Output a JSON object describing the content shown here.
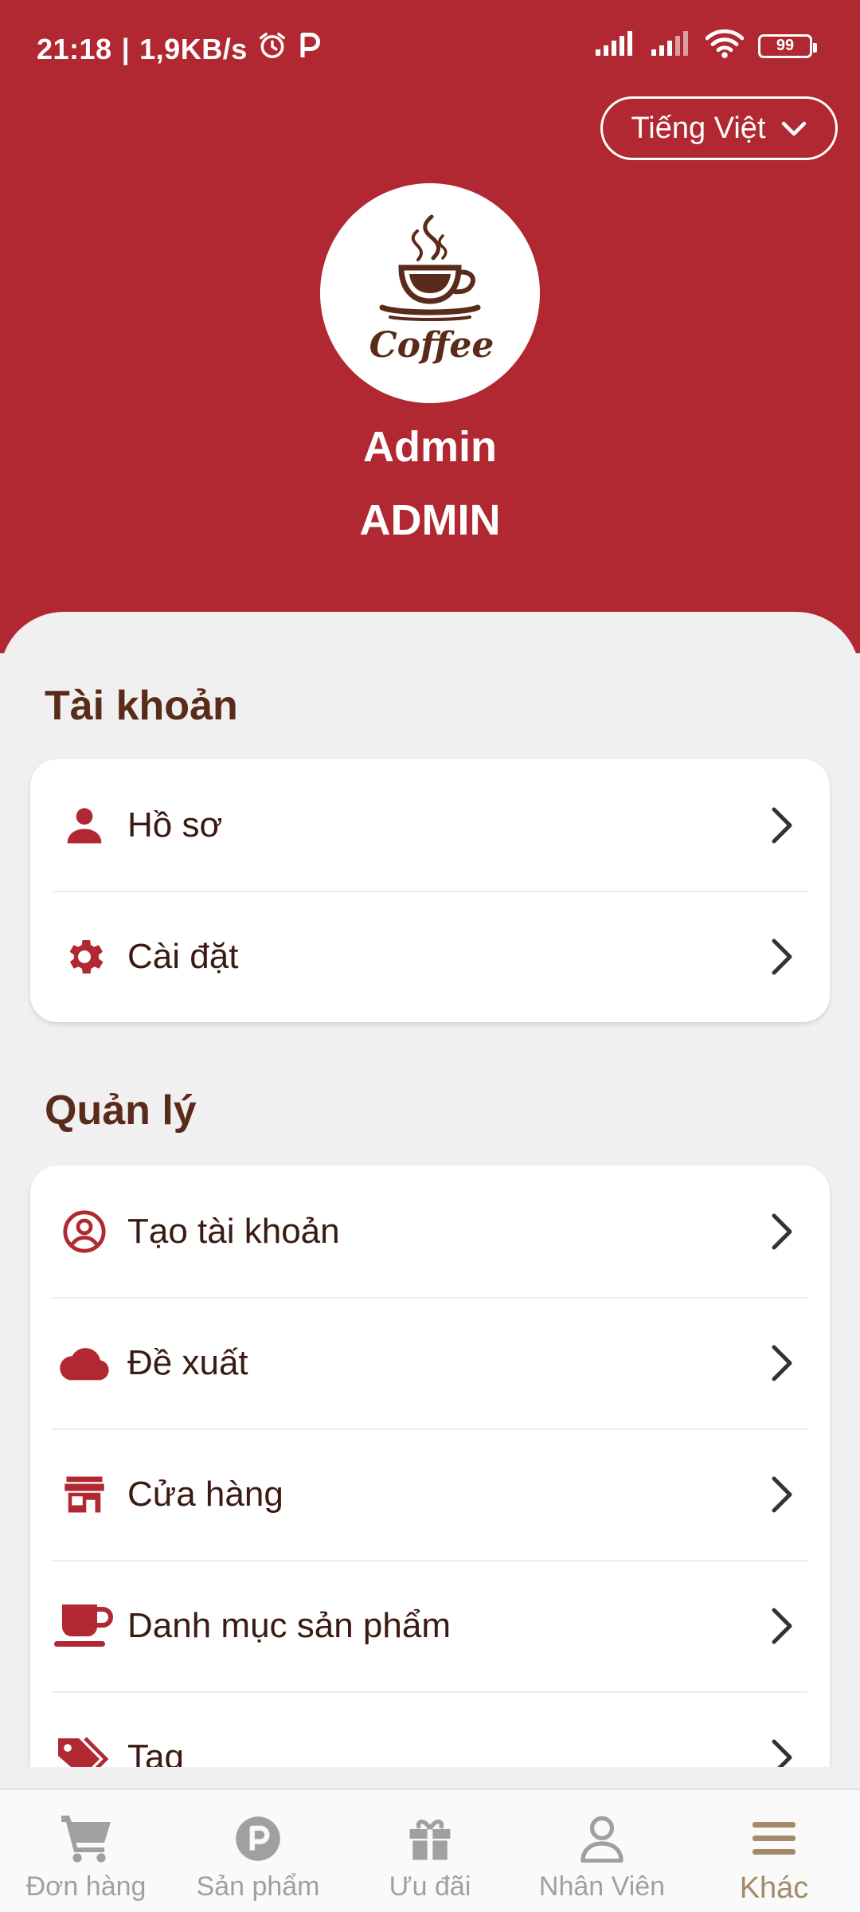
{
  "status_bar": {
    "time": "21:18",
    "separator": "|",
    "net_speed": "1,9KB/s",
    "battery": "99",
    "icons": [
      "alarm-icon",
      "parking-app-icon",
      "signal-icon",
      "signal-icon",
      "wifi-icon",
      "battery-icon"
    ]
  },
  "header": {
    "language": "Tiếng Việt",
    "logo_text": "Coffee",
    "user_name": "Admin",
    "user_role": "ADMIN"
  },
  "sections": {
    "account": {
      "title": "Tài khoản",
      "items": [
        {
          "label": "Hồ sơ",
          "icon": "person-icon"
        },
        {
          "label": "Cài đặt",
          "icon": "gear-icon"
        }
      ]
    },
    "management": {
      "title": "Quản lý",
      "items": [
        {
          "label": "Tạo tài khoản",
          "icon": "account-circle-icon"
        },
        {
          "label": "Đề xuất",
          "icon": "cloud-icon"
        },
        {
          "label": "Cửa hàng",
          "icon": "store-icon"
        },
        {
          "label": "Danh mục sản phẩm",
          "icon": "coffee-cup-icon"
        },
        {
          "label": "Tag",
          "icon": "tag-icon"
        }
      ]
    }
  },
  "bottom_nav": {
    "items": [
      {
        "label": "Đơn hàng",
        "icon": "cart-icon"
      },
      {
        "label": "Sản phẩm",
        "icon": "product-icon"
      },
      {
        "label": "Ưu đãi",
        "icon": "gift-icon"
      },
      {
        "label": "Nhân Viên",
        "icon": "person-outline-icon"
      },
      {
        "label": "Khác",
        "icon": "menu-icon"
      }
    ],
    "active": "Khác"
  },
  "colors": {
    "primary": "#b12832",
    "text_dark": "#3a1a12",
    "nav_active": "#a58a6a",
    "nav_inactive": "#a0a0a0"
  }
}
